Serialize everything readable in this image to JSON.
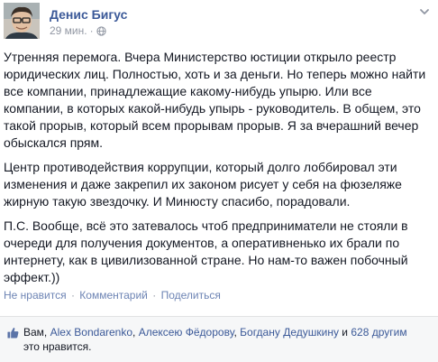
{
  "post": {
    "author": "Денис Бигус",
    "time": "29 мин.",
    "audience_icon": "globe-icon",
    "menu_icon": "chevron-down-icon",
    "paragraphs": [
      "Утренняя перемога. Вчера Министерство юстиции открыло реестр юридических лиц. Полностью, хоть и за деньги. Но теперь можно найти все компании, принадлежащие какому-нибудь упырю. Или все компании, в которых какой-нибудь упырь - руководитель. В общем, это такой прорыв, который всем прорывам прорыв. Я за вчерашний вечер обыскался прям.",
      "Центр противодействия коррупции, который долго лоббировал эти изменения и даже закрепил их законом рисует у себя на фюзеляже жирную такую звездочку. И Минюсту спасибо, порадовали.",
      "П.С. Вообще, всё это затевалось чтоб предприниматели не стояли в очереди для получения документов, а оперативненько их брали по интернету, как в цивилизованной стране. Но нам-то важен побочный эффект.))"
    ]
  },
  "actions": {
    "like": "Не нравится",
    "comment": "Комментарий",
    "share": "Поделиться",
    "separator": "·"
  },
  "likes": {
    "icon": "thumbs-up-icon",
    "prefix": "Вам,",
    "name1": "Alex Bondarenko",
    "name2": "Алексею Фёдорову",
    "name3": "Богдану Дедушкину",
    "and": "и",
    "others": "628 другим",
    "suffix": "это нравится."
  },
  "colors": {
    "link": "#3b5998",
    "muted": "#9197a3",
    "action": "#6d84b4",
    "likes_bg": "#f6f7f8"
  }
}
